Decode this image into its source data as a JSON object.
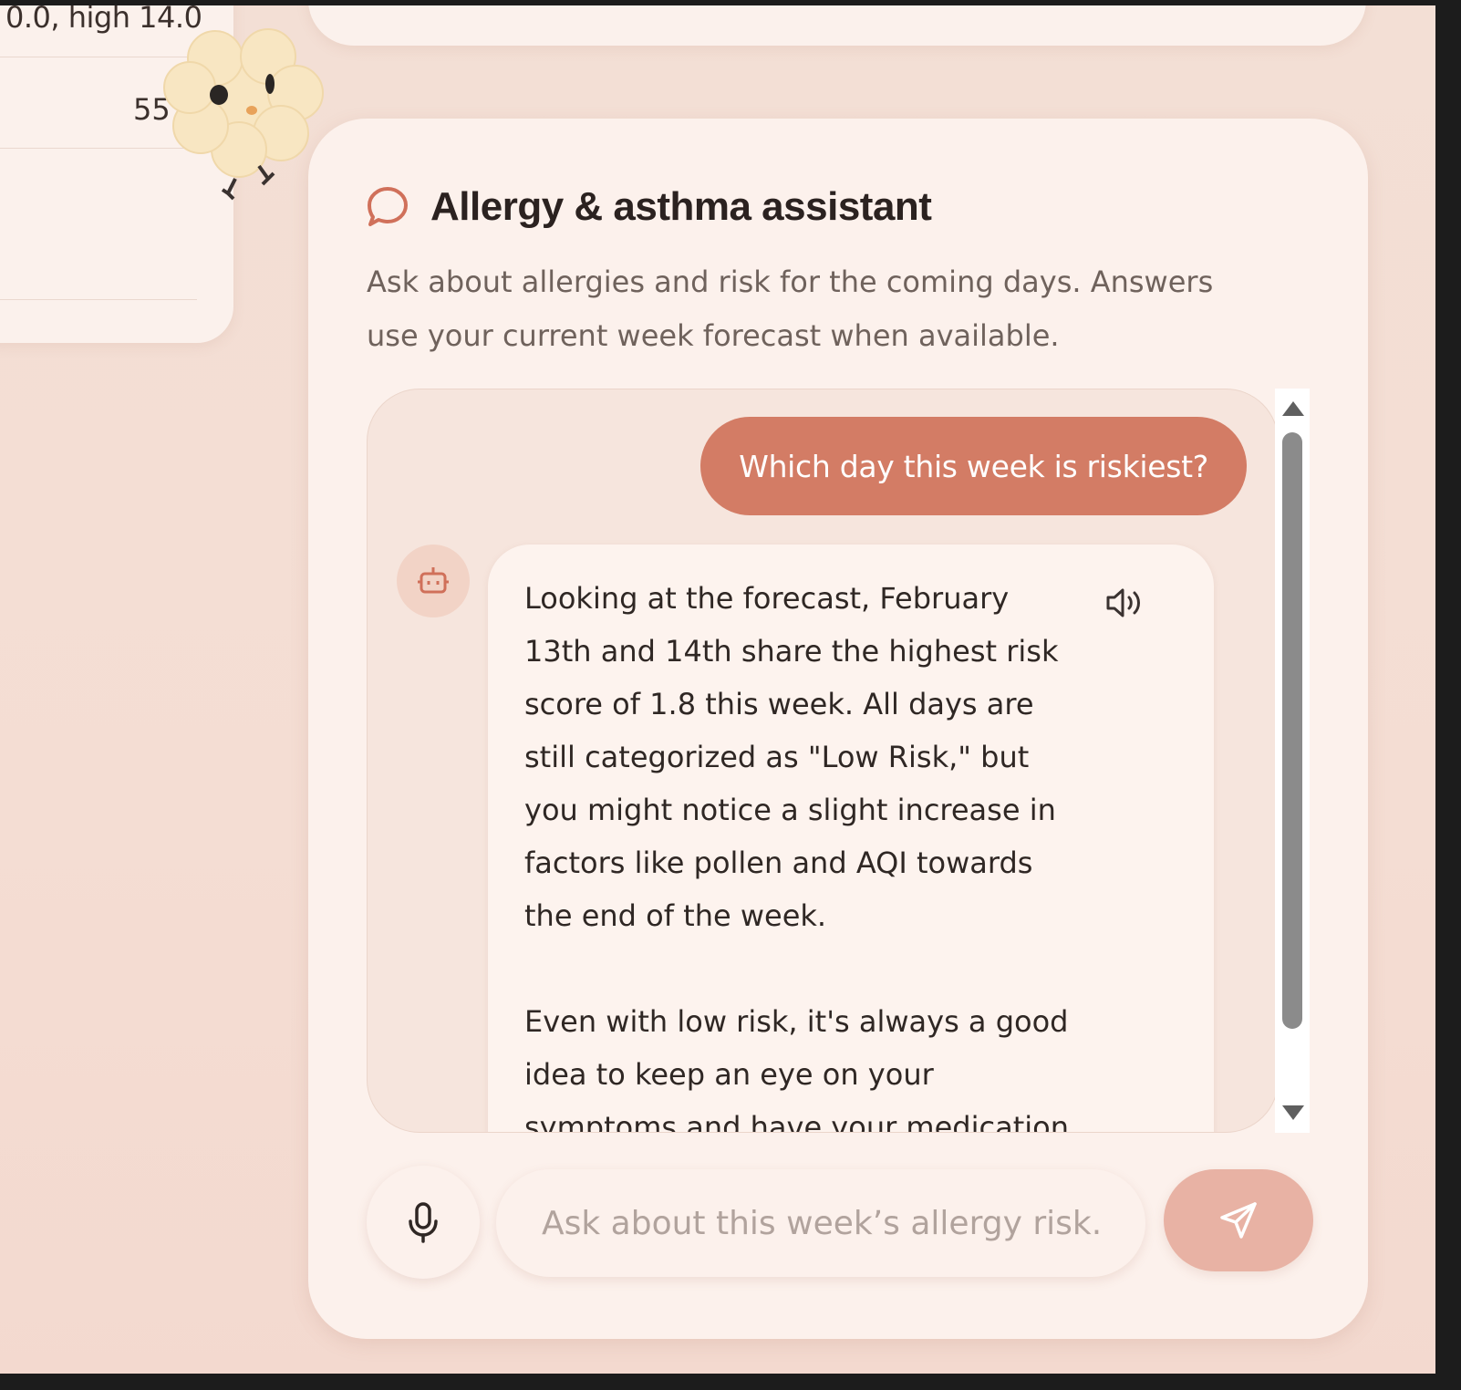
{
  "left_card": {
    "range_text": "0.0, high 14.0",
    "value_text": "55"
  },
  "assistant": {
    "title": "Allergy & asthma assistant",
    "subtitle": "Ask about allergies and risk for the coming days. Answers use your current week forecast when available.",
    "icon": "chat-bubble-icon"
  },
  "chat": {
    "user_message": "Which day this week is riskiest?",
    "bot_message": "Looking at the forecast, February 13th and 14th share the highest risk score of 1.8 this week. All days are still categorized as \"Low Risk,\" but you might notice a slight increase in factors like pollen and AQI towards the end of the week.\n\nEven with low risk, it's always a good idea to keep an eye on your symptoms and have your medication handy.",
    "bot_avatar_icon": "robot-icon",
    "speaker_icon": "speaker-icon"
  },
  "input": {
    "placeholder": "Ask about this week’s allergy risk..",
    "value": "",
    "mic_icon": "microphone-icon",
    "send_icon": "send-icon"
  },
  "colors": {
    "accent": "#d37c65",
    "send_button": "#e8b2a4",
    "background": "#f3dfd5",
    "card": "#fcf1ec"
  }
}
